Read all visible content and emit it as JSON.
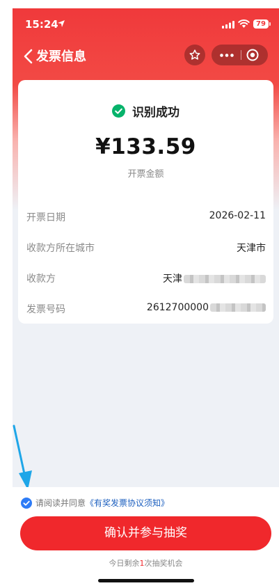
{
  "status_bar": {
    "time": "15:24",
    "battery": "79"
  },
  "nav": {
    "title": "发票信息"
  },
  "result": {
    "status": "识别成功",
    "amount": "¥133.59",
    "amount_label": "开票金额"
  },
  "fields": [
    {
      "label": "开票日期",
      "value": "2026-02-11"
    },
    {
      "label": "收款方所在城市",
      "value": "天津市"
    },
    {
      "label": "收款方",
      "value": "天津"
    },
    {
      "label": "发票号码",
      "value": "2612700000"
    }
  ],
  "agreement": {
    "prefix": "请阅读并同意",
    "link": "《有奖发票协议须知》",
    "checked": true
  },
  "cta": {
    "label": "确认并参与抽奖"
  },
  "remaining": {
    "prefix": "今日剩余",
    "count": "1",
    "suffix": "次抽奖机会"
  },
  "colors": {
    "brand_red": "#f0282c",
    "success_green": "#07b36b",
    "link_blue": "#1c5fbf",
    "checkbox_blue": "#2e7cf6",
    "arrow_blue": "#1ea6e8"
  }
}
